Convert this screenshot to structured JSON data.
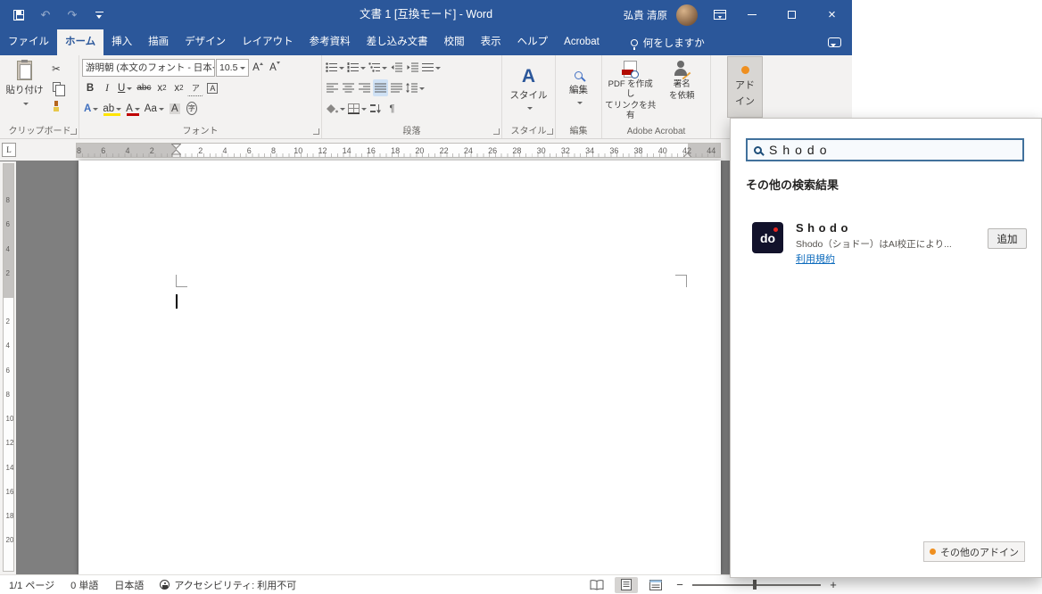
{
  "colors": {
    "titlebar_blue": "#2b579a",
    "ribbon_bg": "#f3f2f1",
    "document_bg": "#7f7f7f",
    "accent_orange": "#ef8f1f",
    "link_blue": "#0f6cbd",
    "highlight_yellow": "#ffe400",
    "font_red": "#c00000"
  },
  "icons": {
    "undo": "↶",
    "redo": "↷",
    "close": "×",
    "scissors": "✂",
    "pilcrow": "¶",
    "zoom_out": "−",
    "zoom_in": "+"
  },
  "titlebar": {
    "title": "文書 1 [互換モード]  -  Word",
    "user": "弘貴 清原"
  },
  "tabs": {
    "file": "ファイル",
    "items": [
      {
        "label": "ホーム"
      },
      {
        "label": "挿入"
      },
      {
        "label": "描画"
      },
      {
        "label": "デザイン"
      },
      {
        "label": "レイアウト"
      },
      {
        "label": "参考資料"
      },
      {
        "label": "差し込み文書"
      },
      {
        "label": "校閲"
      },
      {
        "label": "表示"
      },
      {
        "label": "ヘルプ"
      },
      {
        "label": "Acrobat"
      }
    ],
    "tell_me": "何をしますか"
  },
  "ribbon": {
    "clipboard": {
      "paste": "貼り付け",
      "group": "クリップボード"
    },
    "font": {
      "name": "游明朝 (本文のフォント - 日本",
      "size": "10.5",
      "group": "フォント",
      "bold": "B",
      "italic": "I",
      "underline": "U",
      "strike": "abc",
      "sub_base": "x",
      "sub": "2",
      "sup_base": "x",
      "sup": "2",
      "ruby": "ア",
      "enclose": "A",
      "effects": "A",
      "highlight": "ab",
      "font_color": "A",
      "change_case": "Aa",
      "grow": "A",
      "shrink": "A",
      "shade": "A",
      "circle_char": "字"
    },
    "paragraph": {
      "group": "段落"
    },
    "styles": {
      "icon": "A",
      "label": "スタイル",
      "group": "スタイル"
    },
    "editing": {
      "label": "編集",
      "group": "編集"
    },
    "acrobat": {
      "pdf_line1": "PDF を作成し",
      "pdf_line2": "てリンクを共有",
      "sign_line1": "署名",
      "sign_line2": "を依頼",
      "group": "Adobe Acrobat"
    },
    "addins": {
      "line1": "アド",
      "line2": "イン"
    }
  },
  "ruler": {
    "tab_selector": "L",
    "left_numbers": [
      "8",
      "6",
      "4",
      "2"
    ],
    "numbers": [
      "2",
      "4",
      "6",
      "8",
      "10",
      "12",
      "14",
      "16",
      "18",
      "20",
      "22",
      "24",
      "26",
      "28",
      "30",
      "32",
      "34",
      "36",
      "38",
      "40",
      "42",
      "44"
    ],
    "vertical_margin_numbers": [
      "8",
      "6",
      "4",
      "2"
    ],
    "vertical_numbers": [
      "2",
      "4",
      "6",
      "8",
      "10",
      "12",
      "14",
      "16",
      "18",
      "20"
    ]
  },
  "statusbar": {
    "page": "1/1 ページ",
    "words": "0 単語",
    "language": "日本語",
    "accessibility": "アクセシビリティ: 利用不可"
  },
  "addin_panel": {
    "search_value": "Shodo",
    "results_heading": "その他の検索結果",
    "result": {
      "logo": "do",
      "title": "Shodo",
      "description": "Shodo（ショドー）はAI校正により...",
      "terms_link": "利用規約",
      "add_button": "追加"
    },
    "more_addins": "その他のアドイン"
  }
}
